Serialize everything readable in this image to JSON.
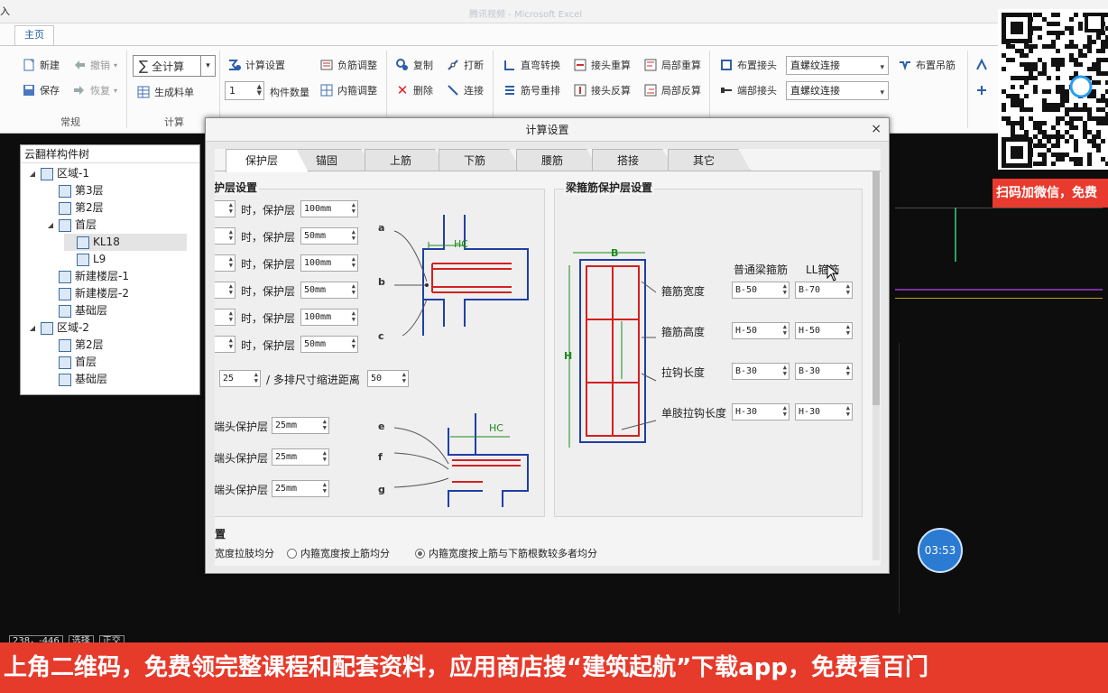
{
  "window": {
    "title_left": "入",
    "title_center": "腾讯视频 - Microsoft Excel"
  },
  "ribbon": {
    "tab": "主页",
    "common": {
      "new": "新建",
      "save": "保存",
      "undo": "撤销",
      "redo": "恢复",
      "label": "常规"
    },
    "calc": {
      "calc_all": "全计算",
      "gen_bom": "生成料单",
      "label": "计算"
    },
    "settings": {
      "calc_settings": "计算设置",
      "count_value": "1",
      "count_label": "构件数量",
      "neg_adjust": "负筋调整",
      "inner_adjust": "内箍调整"
    },
    "edit": {
      "copy": "复制",
      "delete": "删除",
      "break": "打断",
      "connect": "连接"
    },
    "rebar": {
      "straight_bend": "直弯转换",
      "rebar_reorder": "筋号重排",
      "joint_recalc": "接头重算",
      "joint_reverse": "接头反算",
      "local_recalc": "局部重算",
      "local_reverse": "局部反算"
    },
    "joint": {
      "arrange_joint": "布置接头",
      "end_joint": "端部接头",
      "combo1": "直螺纹连接",
      "combo2": "直螺纹连接",
      "arrange_hanger": "布置吊筋"
    }
  },
  "qr": {
    "banner": "扫码加微信，免费"
  },
  "tree": {
    "title": "云翻样构件树",
    "nodes": [
      {
        "label": "区域-1",
        "level": 0,
        "toggle": "◢"
      },
      {
        "label": "第3层",
        "level": 1,
        "toggle": ""
      },
      {
        "label": "第2层",
        "level": 1,
        "toggle": ""
      },
      {
        "label": "首层",
        "level": 1,
        "toggle": "◢"
      },
      {
        "label": "KL18",
        "level": 2,
        "toggle": "",
        "selected": true
      },
      {
        "label": "L9",
        "level": 2,
        "toggle": ""
      },
      {
        "label": "新建楼层-1",
        "level": 1,
        "toggle": ""
      },
      {
        "label": "新建楼层-2",
        "level": 1,
        "toggle": ""
      },
      {
        "label": "基础层",
        "level": 1,
        "toggle": ""
      },
      {
        "label": "区域-2",
        "level": 0,
        "toggle": "◢"
      },
      {
        "label": "第2层",
        "level": 1,
        "toggle": ""
      },
      {
        "label": "首层",
        "level": 1,
        "toggle": ""
      },
      {
        "label": "基础层",
        "level": 1,
        "toggle": ""
      }
    ]
  },
  "dialog": {
    "title": "计算设置",
    "close": "×",
    "tabs": [
      "保护层",
      "锚固",
      "上筋",
      "下筋",
      "腰筋",
      "搭接",
      "其它"
    ],
    "left": {
      "title": "护层设置",
      "rows": [
        {
          "when": "时，保护层",
          "value": "100mm"
        },
        {
          "when": "时，保护层",
          "value": "50mm"
        },
        {
          "when": "时，保护层",
          "value": "100mm"
        },
        {
          "when": "时，保护层",
          "value": "50mm"
        },
        {
          "when": "时，保护层",
          "value": "100mm"
        },
        {
          "when": "时，保护层",
          "value": "50mm"
        }
      ],
      "multi_value": "25",
      "multi_label": "/ 多排尺寸缩进距离",
      "multi_value2": "50",
      "end_rows": [
        {
          "label": "端头保护层",
          "value": "25mm"
        },
        {
          "label": "端头保护层",
          "value": "25mm"
        },
        {
          "label": "端头保护层",
          "value": "25mm"
        }
      ],
      "letters_top": [
        "a",
        "b",
        "c"
      ],
      "letters_bottom": [
        "e",
        "f",
        "g"
      ],
      "hc": "HC"
    },
    "right": {
      "title": "梁箍筋保护层设置",
      "col1": "普通梁箍筋",
      "col2": "LL箍筋",
      "rows": [
        {
          "label": "箍筋宽度",
          "v1": "B-50",
          "v2": "B-70"
        },
        {
          "label": "箍筋高度",
          "v1": "H-50",
          "v2": "H-50"
        },
        {
          "label": "拉钩长度",
          "v1": "B-30",
          "v2": "B-30"
        },
        {
          "label": "单肢拉钩长度",
          "v1": "H-30",
          "v2": "H-30"
        }
      ],
      "b": "B",
      "h": "H"
    },
    "bottom": {
      "title": "置",
      "opt1": "宽度拉肢均分",
      "opt2": "内箍宽度按上筋均分",
      "opt3": "内箍宽度按上筋与下筋根数较多者均分"
    }
  },
  "status": {
    "coords": "238，-446",
    "mode1": "选择",
    "mode2": "正交"
  },
  "timer": "03:53",
  "banner": "上角二维码，免费领完整课程和配套资料，应用商店搜“建筑起航”下载app，免费看百门"
}
